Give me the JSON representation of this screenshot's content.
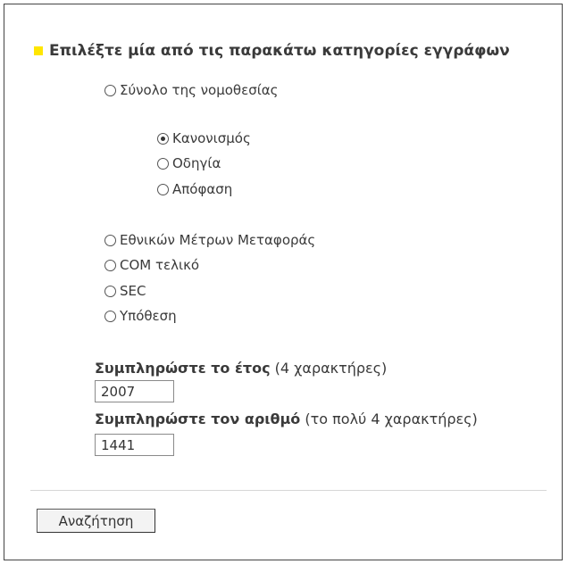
{
  "form": {
    "heading": "Επιλέξτε μία από τις παρακάτω κατηγορίες εγγράφων",
    "options": {
      "legislation": {
        "label": "Σύνολο της νομοθεσίας",
        "checked": false
      },
      "regulation": {
        "label": "Κανονισμός",
        "checked": true
      },
      "directive": {
        "label": "Οδηγία",
        "checked": false
      },
      "decision": {
        "label": "Απόφαση",
        "checked": false
      },
      "national": {
        "label": "Εθνικών Μέτρων Μεταφοράς",
        "checked": false
      },
      "com": {
        "label": "COM τελικό",
        "checked": false
      },
      "sec": {
        "label": "SEC",
        "checked": false
      },
      "case": {
        "label": "Υπόθεση",
        "checked": false
      }
    },
    "year": {
      "label_bold": "Συμπληρώστε το έτος",
      "label_hint": "(4 χαρακτήρες)",
      "value": "2007"
    },
    "number": {
      "label_bold": "Συμπληρώστε τον αριθμό",
      "label_hint": "(το πολύ 4 χαρακτήρες)",
      "value": "1441"
    },
    "search_button": "Αναζήτηση"
  },
  "colors": {
    "bullet": "#ffe600",
    "text": "#3a3a3a",
    "border": "#444444"
  }
}
